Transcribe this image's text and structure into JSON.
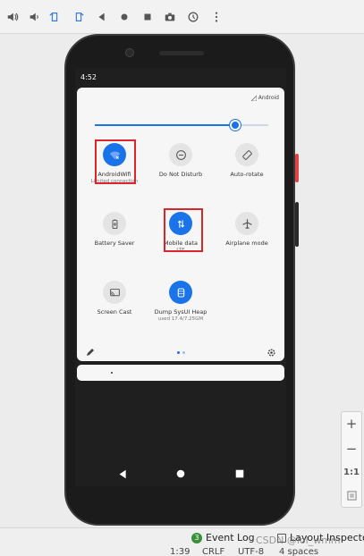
{
  "status_bar": {
    "time": "4:52"
  },
  "quick_settings": {
    "carrier": "Android",
    "brightness_fraction": 0.81,
    "tiles": [
      {
        "label": "AndroidWifi",
        "sub": "Limited connection",
        "on": true,
        "icon": "wifi-icon"
      },
      {
        "label": "Do Not Disturb",
        "sub": "",
        "on": false,
        "icon": "do-not-disturb-icon"
      },
      {
        "label": "Auto-rotate",
        "sub": "",
        "on": false,
        "icon": "auto-rotate-icon"
      },
      {
        "label": "Battery Saver",
        "sub": "",
        "on": false,
        "icon": "battery-icon"
      },
      {
        "label": "Mobile data",
        "sub": "LTE",
        "on": true,
        "icon": "mobile-data-icon"
      },
      {
        "label": "Airplane mode",
        "sub": "",
        "on": false,
        "icon": "airplane-icon"
      },
      {
        "label": "Screen Cast",
        "sub": "",
        "on": false,
        "icon": "cast-icon"
      },
      {
        "label": "Dump SysUI Heap",
        "sub": "used 17.4/7.25GM",
        "on": true,
        "icon": "heap-icon"
      }
    ]
  },
  "zoom_panel": {
    "zoom_in": "+",
    "zoom_out": "−",
    "actual_size": "1:1"
  },
  "ide": {
    "event_log_badge": "3",
    "event_log": "Event Log",
    "layout_inspector": "Layout Inspecto",
    "line_col": "1:39",
    "line_sep": "CRLF",
    "encoding": "UTF-8",
    "indent": "4 spaces"
  },
  "watermark": "CSDN @lol_wmm",
  "colors": {
    "accent": "#1a73e8",
    "highlight": "#d9262b"
  }
}
